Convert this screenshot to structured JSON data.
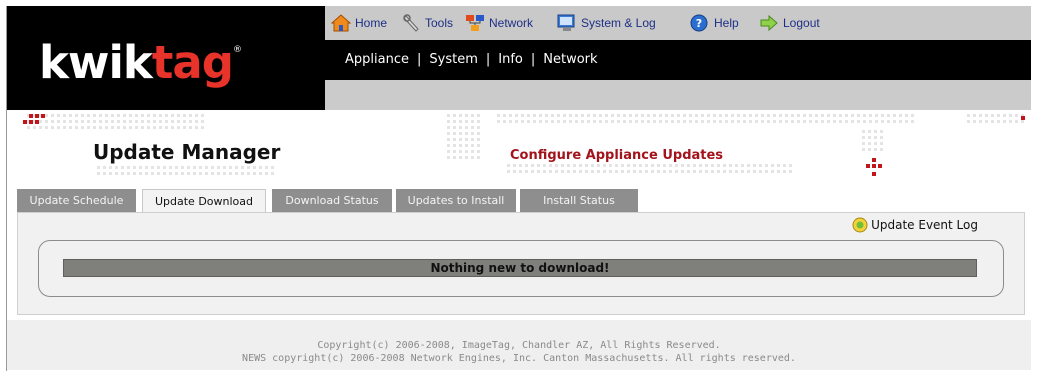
{
  "brand": {
    "part1": "kwik",
    "part2": "tag",
    "registered": "®"
  },
  "topnav": {
    "items": [
      {
        "label": "Home",
        "icon": "home-icon"
      },
      {
        "label": "Tools",
        "icon": "tools-icon"
      },
      {
        "label": "Network",
        "icon": "network-icon"
      },
      {
        "label": "System & Log",
        "icon": "system-log-icon"
      },
      {
        "label": "Help",
        "icon": "help-icon"
      },
      {
        "label": "Logout",
        "icon": "logout-icon"
      }
    ]
  },
  "menu": {
    "items": [
      "Appliance",
      "System",
      "Info",
      "Network"
    ],
    "separator": "|"
  },
  "banner": {
    "title": "Update Manager",
    "subtitle": "Configure Appliance Updates"
  },
  "tabs": [
    {
      "label": "Update Schedule",
      "active": false
    },
    {
      "label": "Update Download",
      "active": true
    },
    {
      "label": "Download Status",
      "active": false
    },
    {
      "label": "Updates to Install",
      "active": false
    },
    {
      "label": "Install Status",
      "active": false
    }
  ],
  "content": {
    "event_log_label": "Update Event Log",
    "message": "Nothing new to download!"
  },
  "footer": {
    "line1": "Copyright(c) 2006-2008, ImageTag, Chandler AZ, All Rights Reserved.",
    "line2": "NEWS copyright(c) 2006-2008 Network Engines, Inc. Canton Massachusetts.  All rights reserved."
  },
  "colors": {
    "accent_red": "#a3131b",
    "logo_red": "#e8332a",
    "nav_text": "#1e2f86",
    "tab_inactive": "#8e8e8e",
    "message_bar": "#7f807b"
  }
}
